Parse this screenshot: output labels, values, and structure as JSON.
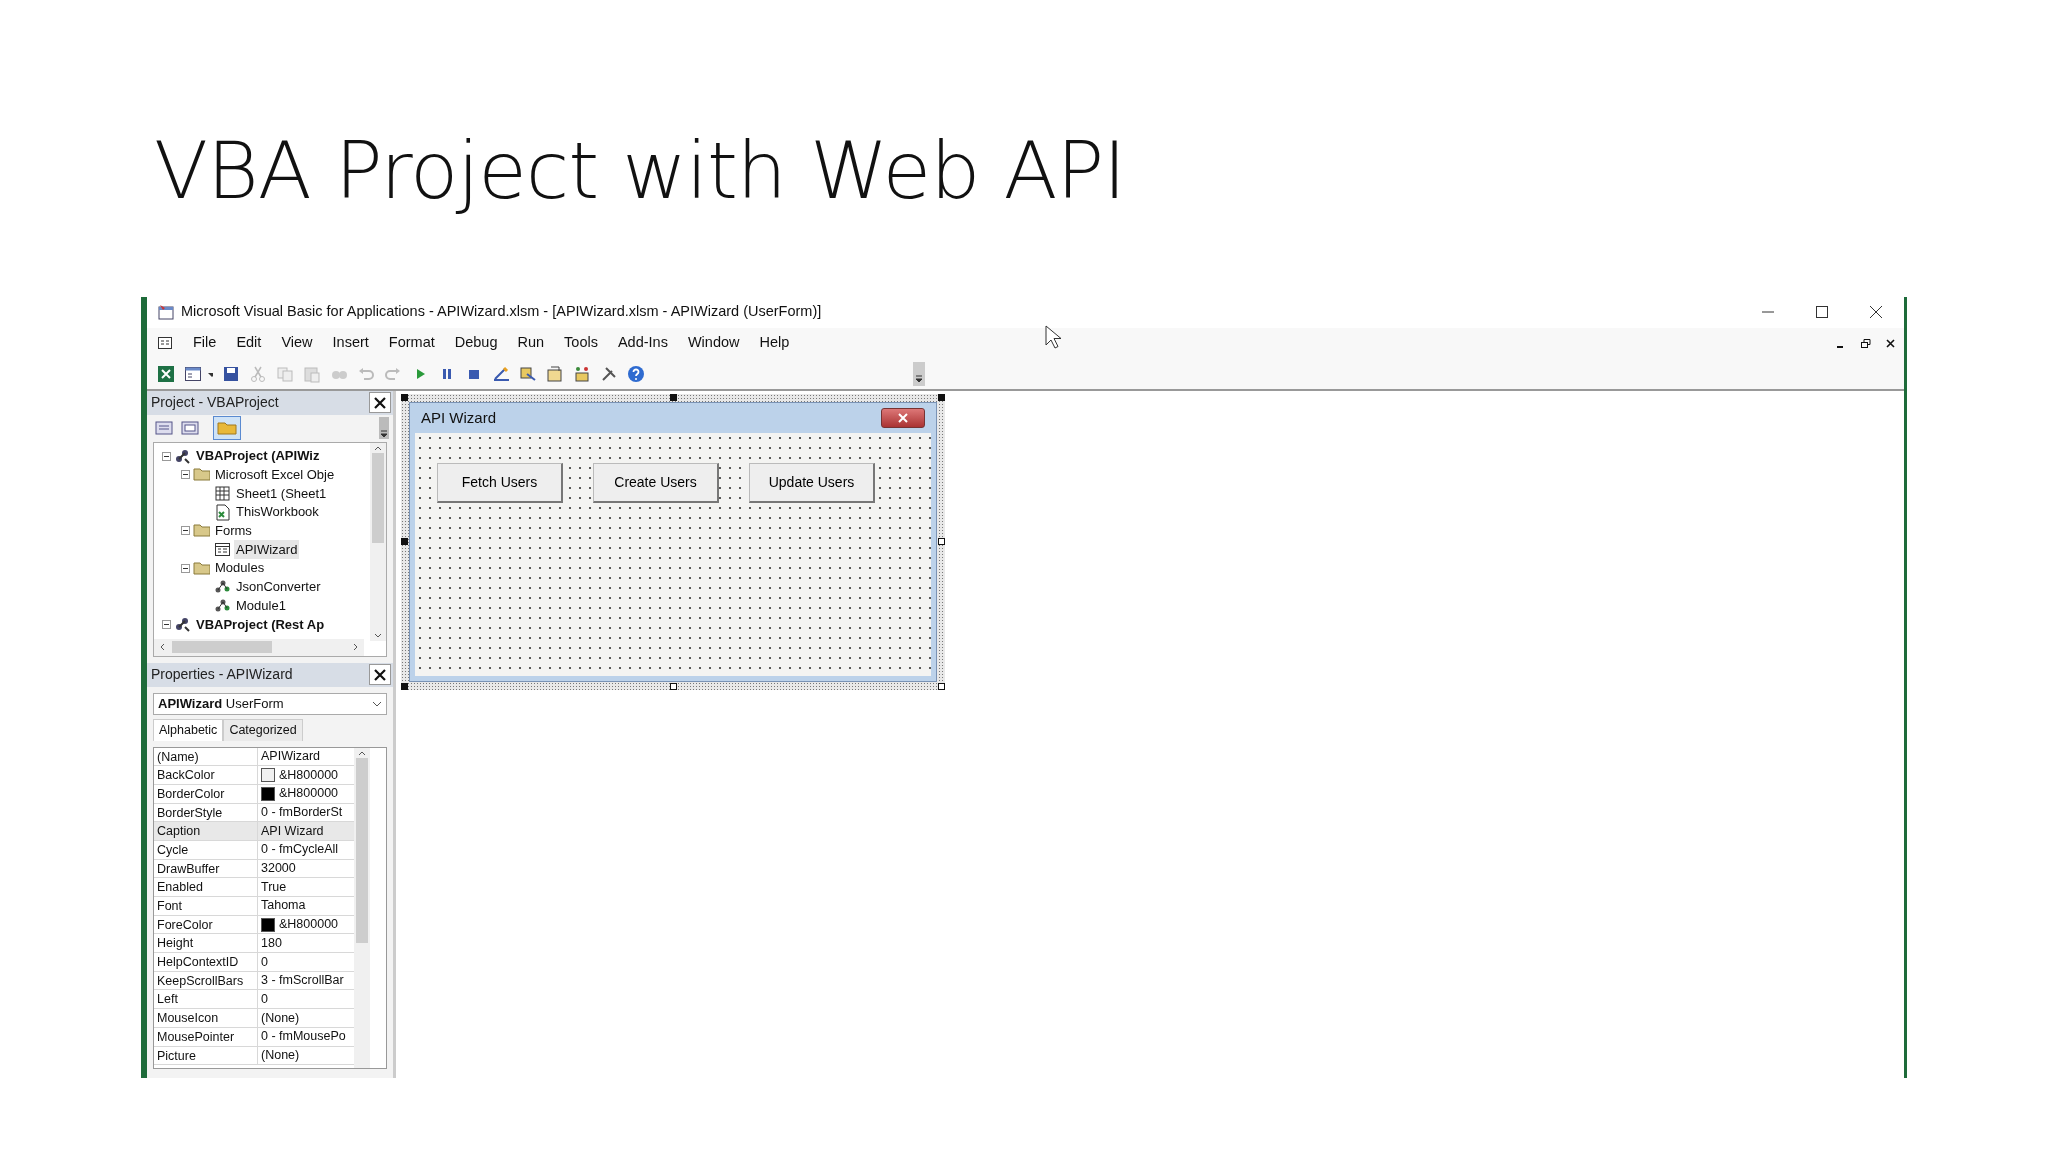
{
  "slide_title": "VBA Project with Web API",
  "window": {
    "title": "Microsoft Visual Basic for Applications - APIWizard.xlsm - [APIWizard.xlsm - APIWizard (UserForm)]",
    "menu": [
      "File",
      "Edit",
      "View",
      "Insert",
      "Format",
      "Debug",
      "Run",
      "Tools",
      "Add-Ins",
      "Window",
      "Help"
    ]
  },
  "project": {
    "title": "Project - VBAProject",
    "tree": [
      {
        "label": "VBAProject (APIWiz",
        "kind": "project",
        "expanded": true,
        "selected": false,
        "children": [
          {
            "label": "Microsoft Excel Obje",
            "kind": "folder",
            "expanded": true,
            "selected": false,
            "children": [
              {
                "label": "Sheet1 (Sheet1",
                "kind": "sheet",
                "selected": false
              },
              {
                "label": "ThisWorkbook",
                "kind": "workbook",
                "selected": false
              }
            ]
          },
          {
            "label": "Forms",
            "kind": "folder",
            "expanded": true,
            "selected": false,
            "children": [
              {
                "label": "APIWizard",
                "kind": "form",
                "selected": true
              }
            ]
          },
          {
            "label": "Modules",
            "kind": "folder",
            "expanded": true,
            "selected": false,
            "children": [
              {
                "label": "JsonConverter",
                "kind": "module",
                "selected": false
              },
              {
                "label": "Module1",
                "kind": "module",
                "selected": false
              }
            ]
          }
        ]
      },
      {
        "label": "VBAProject (Rest Ap",
        "kind": "project",
        "expanded": true,
        "selected": false
      }
    ]
  },
  "properties": {
    "title": "Properties - APIWizard",
    "selector": "**APIWizard** UserForm",
    "tabs": [
      {
        "label": "Alphabetic",
        "selected": true
      },
      {
        "label": "Categorized",
        "selected": false
      }
    ],
    "rows": [
      {
        "name": "(Name)",
        "value": "APIWizard",
        "selected": false
      },
      {
        "name": "BackColor",
        "value": "&H800000",
        "color": "#f0f0f0",
        "selected": false
      },
      {
        "name": "BorderColor",
        "value": "&H800000",
        "color": "#000000",
        "selected": false
      },
      {
        "name": "BorderStyle",
        "value": "0 - fmBorderSt",
        "selected": false
      },
      {
        "name": "Caption",
        "value": "API Wizard",
        "selected": true
      },
      {
        "name": "Cycle",
        "value": "0 - fmCycleAll",
        "selected": false
      },
      {
        "name": "DrawBuffer",
        "value": "32000",
        "selected": false
      },
      {
        "name": "Enabled",
        "value": "True",
        "selected": false
      },
      {
        "name": "Font",
        "value": "Tahoma",
        "selected": false
      },
      {
        "name": "ForeColor",
        "value": "&H800000",
        "color": "#000000",
        "selected": false
      },
      {
        "name": "Height",
        "value": "180",
        "selected": false
      },
      {
        "name": "HelpContextID",
        "value": "0",
        "selected": false
      },
      {
        "name": "KeepScrollBars",
        "value": "3 - fmScrollBar",
        "selected": false
      },
      {
        "name": "Left",
        "value": "0",
        "selected": false
      },
      {
        "name": "MouseIcon",
        "value": "(None)",
        "selected": false
      },
      {
        "name": "MousePointer",
        "value": "0 - fmMousePo",
        "selected": false
      },
      {
        "name": "Picture",
        "value": "(None)",
        "selected": false
      }
    ]
  },
  "userform": {
    "title": "API Wizard",
    "buttons": [
      "Fetch Users",
      "Create Users",
      "Update Users"
    ]
  }
}
